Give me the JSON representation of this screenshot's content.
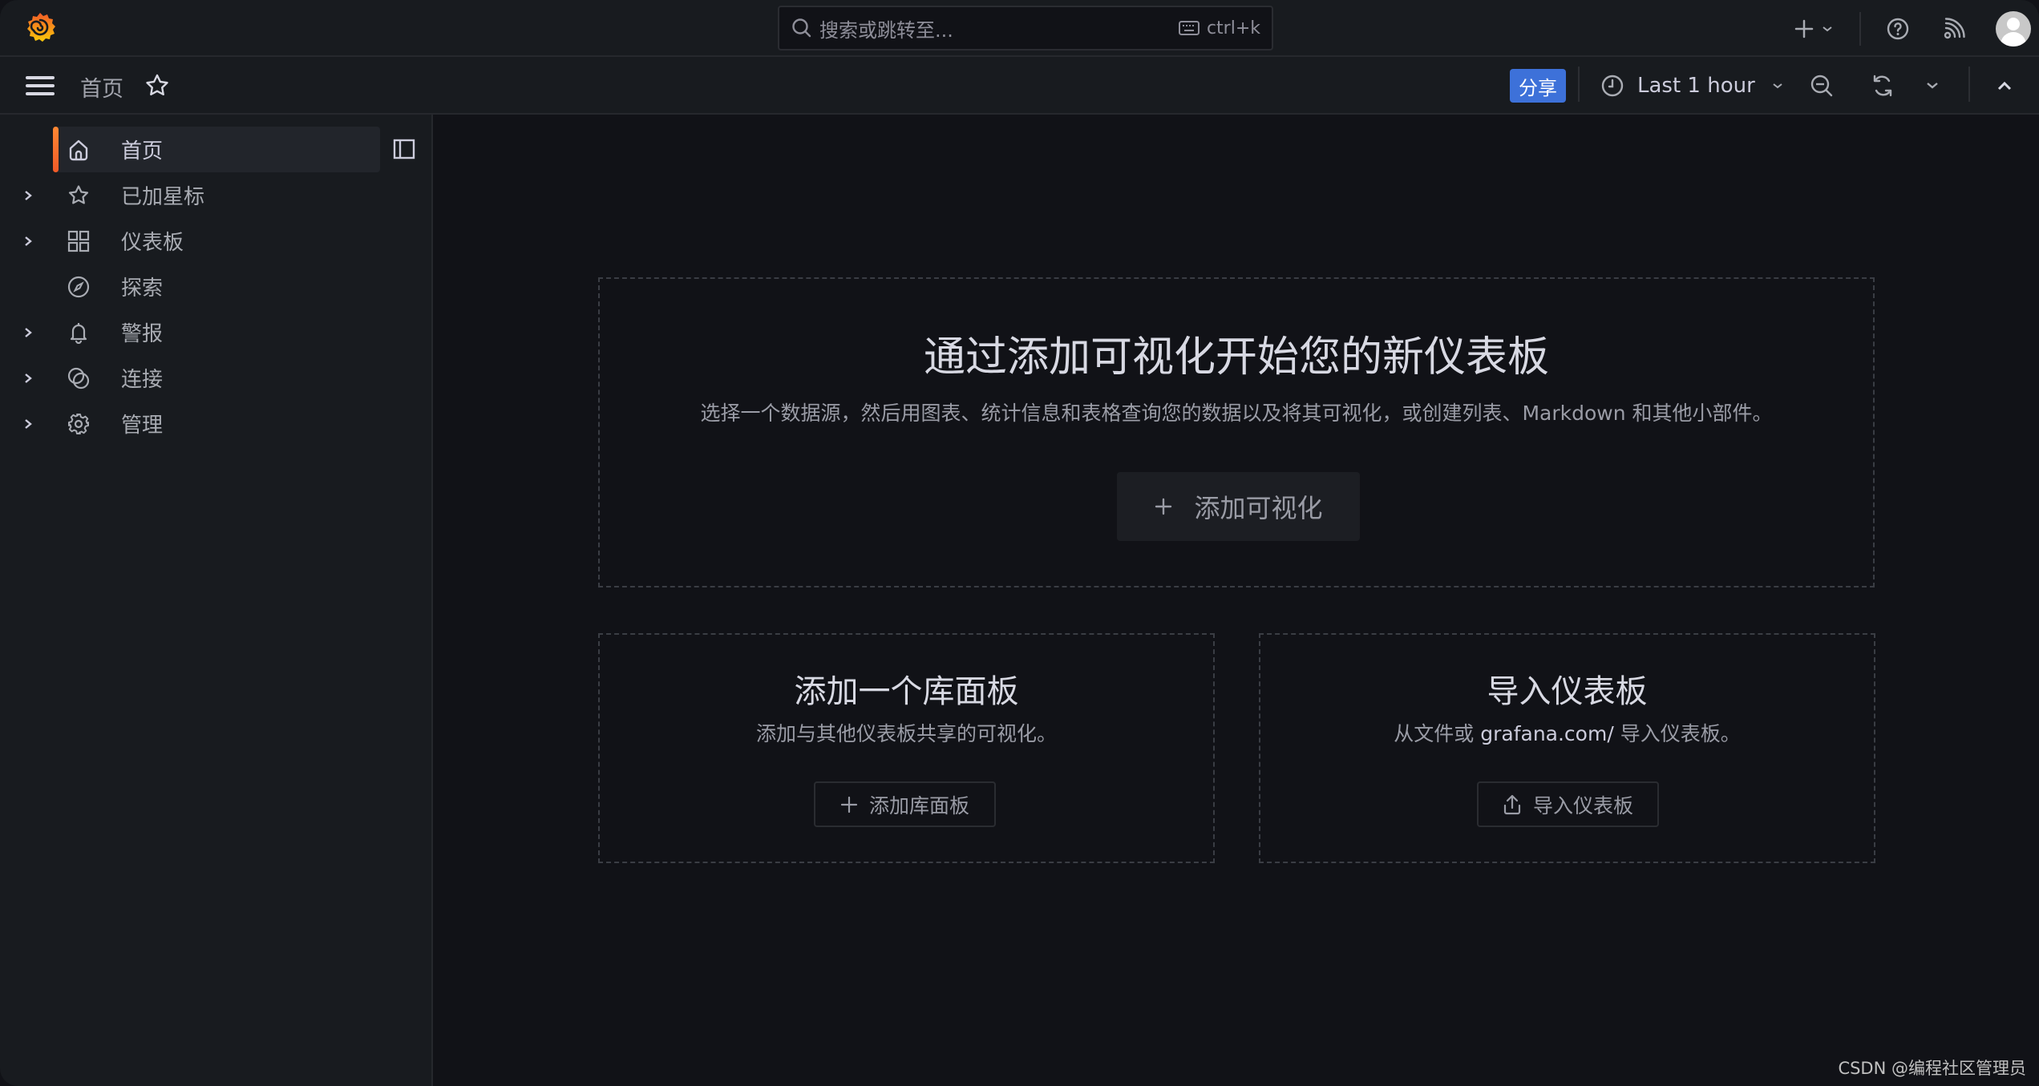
{
  "topbar": {
    "search": {
      "placeholder": "搜索或跳转至...",
      "shortcut": "ctrl+k"
    },
    "icons": [
      "grafana-logo",
      "search-icon",
      "keyboard-icon",
      "plus-icon",
      "chevron-down-icon",
      "help-icon",
      "rss-icon",
      "avatar"
    ]
  },
  "navbar": {
    "breadcrumb": "首页",
    "share_label": "分享",
    "time_range": "Last 1 hour",
    "accent": "#3d71d9"
  },
  "sidebar": {
    "items": [
      {
        "label": "首页",
        "icon": "home-icon",
        "expandable": false,
        "active": true
      },
      {
        "label": "已加星标",
        "icon": "star-icon",
        "expandable": true,
        "active": false
      },
      {
        "label": "仪表板",
        "icon": "apps-icon",
        "expandable": true,
        "active": false
      },
      {
        "label": "探索",
        "icon": "compass-icon",
        "expandable": false,
        "active": false
      },
      {
        "label": "警报",
        "icon": "bell-icon",
        "expandable": true,
        "active": false
      },
      {
        "label": "连接",
        "icon": "link-icon",
        "expandable": true,
        "active": false
      },
      {
        "label": "管理",
        "icon": "gear-icon",
        "expandable": true,
        "active": false
      }
    ],
    "active_color": "#f05a28"
  },
  "main": {
    "hero": {
      "title": "通过添加可视化开始您的新仪表板",
      "subtitle": "选择一个数据源，然后用图表、统计信息和表格查询您的数据以及将其可视化，或创建列表、Markdown 和其他小部件。",
      "button": "添加可视化"
    },
    "library": {
      "title": "添加一个库面板",
      "subtitle": "添加与其他仪表板共享的可视化。",
      "button": "添加库面板"
    },
    "import": {
      "title": "导入仪表板",
      "subtitle_pre": "从文件或 ",
      "subtitle_link": "grafana.com/",
      "subtitle_post": " 导入仪表板。",
      "button": "导入仪表板"
    }
  },
  "watermark": "CSDN @编程社区管理员"
}
